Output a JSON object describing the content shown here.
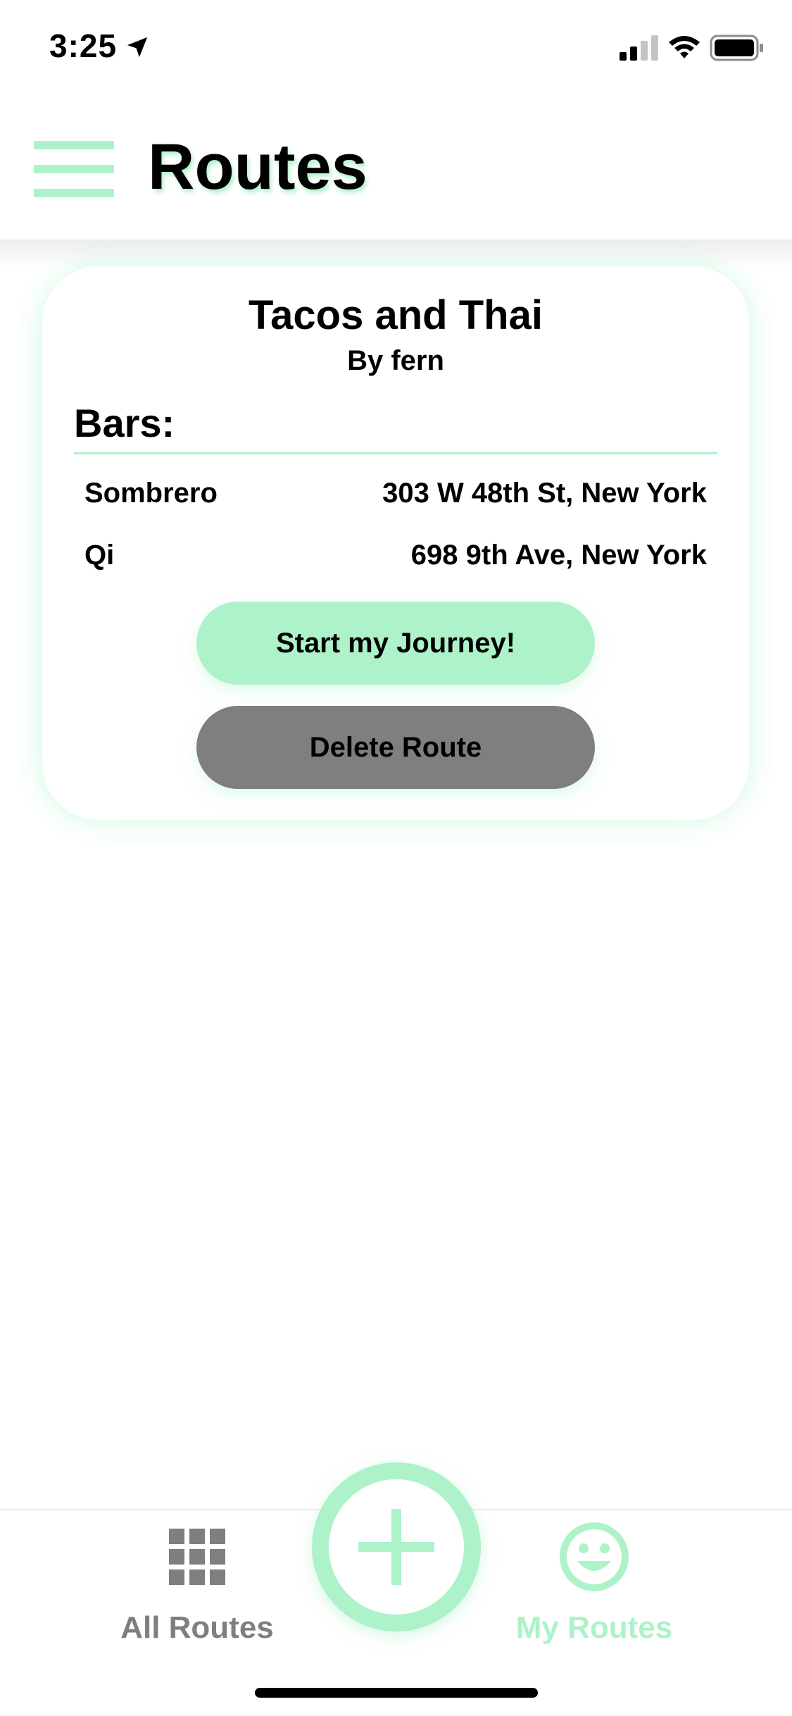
{
  "status_bar": {
    "time": "3:25",
    "icons": [
      "location-arrow-icon",
      "signal-icon",
      "wifi-icon",
      "battery-icon"
    ]
  },
  "header": {
    "title": "Routes",
    "menu_icon": "hamburger-menu-icon"
  },
  "route_card": {
    "title": "Tacos and Thai",
    "author": "By fern",
    "bars_heading": "Bars:",
    "bars": [
      {
        "name": "Sombrero",
        "address": "303 W 48th St, New York"
      },
      {
        "name": "Qi",
        "address": "698 9th Ave, New York"
      }
    ],
    "start_button": "Start my Journey!",
    "delete_button": "Delete Route"
  },
  "tab_bar": {
    "all_routes": {
      "label": "All Routes",
      "icon": "grid-icon"
    },
    "add": {
      "icon": "plus-icon"
    },
    "my_routes": {
      "label": "My Routes",
      "icon": "smiley-face-icon"
    }
  },
  "colors": {
    "accent": "#adf2c9",
    "gray": "#7f7f7f",
    "text": "#000000",
    "background": "#ffffff"
  }
}
